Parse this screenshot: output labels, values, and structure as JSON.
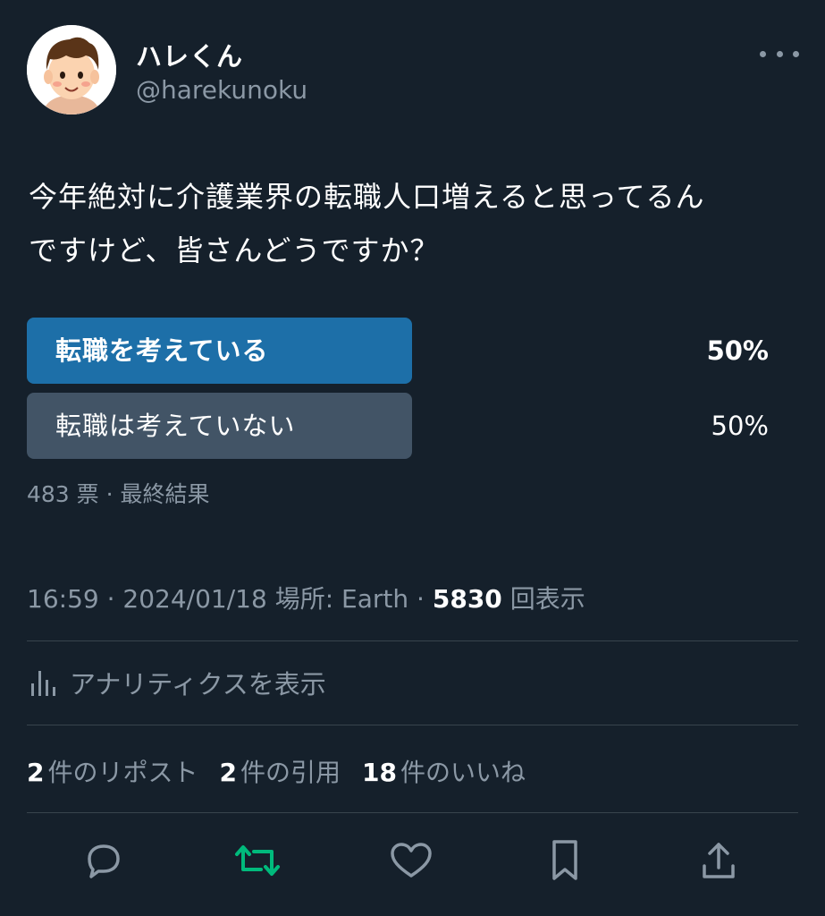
{
  "user": {
    "name": "ハレくん",
    "handle": "@harekunoku"
  },
  "tweet": {
    "text_line1": "今年絶対に介護業界の転職人口増えると思ってるん",
    "text_line2": "ですけど、皆さんどうですか？"
  },
  "poll": {
    "options": [
      {
        "label": "転職を考えている",
        "percent": "50%",
        "fill_fraction": 0.5,
        "winner": true
      },
      {
        "label": "転職は考えていない",
        "percent": "50%",
        "fill_fraction": 0.5,
        "winner": false
      }
    ],
    "votes": "483 票",
    "status": "最終結果"
  },
  "meta": {
    "time": "16:59",
    "date": "2024/01/18",
    "location": "場所: Earth",
    "views_count": "5830",
    "views_label": "回表示"
  },
  "analytics_label": "アナリティクスを表示",
  "stats": {
    "reposts_count": "2",
    "reposts_label": "件のリポスト",
    "quotes_count": "2",
    "quotes_label": "件の引用",
    "likes_count": "18",
    "likes_label": "件のいいね"
  },
  "colors": {
    "background": "#15202b",
    "poll_winner": "#1d6fa8",
    "poll_other": "#425466",
    "retweet_active": "#00ba7c",
    "secondary_text": "#8b98a5"
  },
  "icons": {
    "more": "more-icon",
    "analytics": "bar-chart-icon",
    "reply": "reply-icon",
    "retweet": "retweet-icon",
    "like": "heart-icon",
    "bookmark": "bookmark-icon",
    "share": "share-icon"
  }
}
